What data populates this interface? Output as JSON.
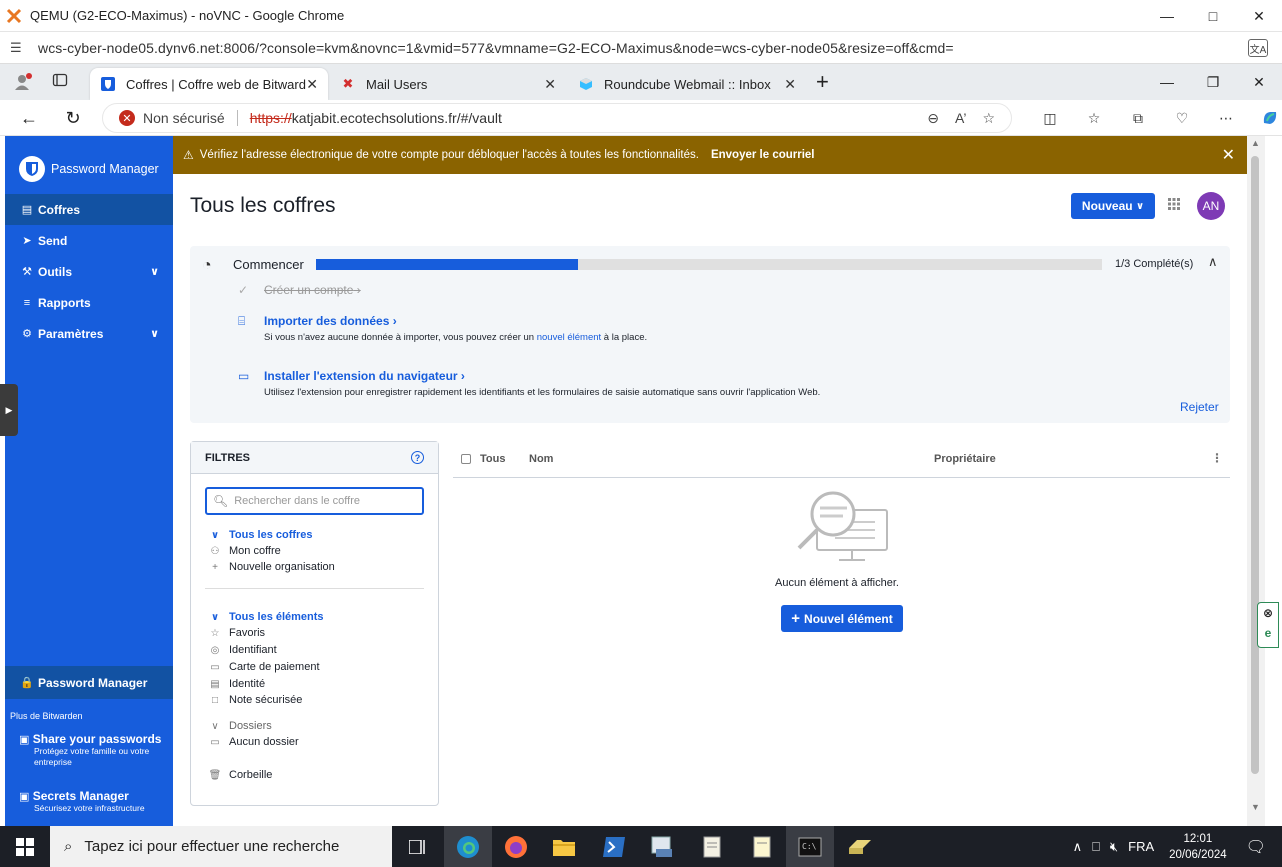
{
  "outer_window": {
    "title": "QEMU (G2-ECO-Maximus) - noVNC - Google Chrome",
    "url": "wcs-cyber-node05.dynv6.net:8006/?console=kvm&novnc=1&vmid=577&vmname=G2-ECO-Maximus&node=wcs-cyber-node05&resize=off&cmd="
  },
  "tabs": [
    {
      "label": "Coffres | Coffre web de Bitwarden",
      "icon": "bitwarden-icon",
      "active": true
    },
    {
      "label": "Mail Users",
      "icon": "mail-icon",
      "active": false
    },
    {
      "label": "Roundcube Webmail :: Inbox",
      "icon": "roundcube-icon",
      "active": false
    }
  ],
  "address": {
    "security_label": "Non sécurisé",
    "scheme": "https://",
    "rest": "katjabit.ecotechsolutions.fr/#/vault"
  },
  "sidebar": {
    "brand": "Password Manager",
    "items": [
      {
        "label": "Coffres",
        "icon": "vault-icon",
        "active": true
      },
      {
        "label": "Send",
        "icon": "send-icon"
      },
      {
        "label": "Outils",
        "icon": "tools-icon",
        "expandable": true
      },
      {
        "label": "Rapports",
        "icon": "reports-icon"
      },
      {
        "label": "Paramètres",
        "icon": "settings-icon",
        "expandable": true
      }
    ],
    "product_switch": "Password Manager",
    "more_label": "Plus de Bitwarden",
    "promos": [
      {
        "title": "Share your passwords",
        "desc": "Protégez votre famille ou votre entreprise"
      },
      {
        "title": "Secrets Manager",
        "desc": "Sécurisez votre infrastructure"
      }
    ]
  },
  "banner": {
    "text": "Vérifiez l'adresse électronique de votre compte pour débloquer l'accès à toutes les fonctionnalités.",
    "link": "Envoyer le courriel"
  },
  "header": {
    "title": "Tous les coffres",
    "new_button": "Nouveau",
    "avatar": "AN"
  },
  "onboarding": {
    "title": "Commencer",
    "progress": 0.333,
    "count": "1/3 Complété(s)",
    "steps": [
      {
        "label": "Créer un compte",
        "done": true
      },
      {
        "label": "Importer des données",
        "desc_before": "Si vous n'avez aucune donnée à importer, vous pouvez créer un ",
        "desc_link": "nouvel élément",
        "desc_after": " à la place."
      },
      {
        "label": "Installer l'extension du navigateur",
        "desc": "Utilisez l'extension pour enregistrer rapidement les identifiants et les formulaires de saisie automatique sans ouvrir l'application Web."
      }
    ],
    "dismiss": "Rejeter"
  },
  "filters": {
    "title": "FILTRES",
    "search_placeholder": "Rechercher dans le coffre",
    "vaults_head": "Tous les coffres",
    "vaults": [
      "Mon coffre",
      "Nouvelle organisation"
    ],
    "items_head": "Tous les éléments",
    "items": [
      "Favoris",
      "Identifiant",
      "Carte de paiement",
      "Identité",
      "Note sécurisée"
    ],
    "folders_head": "Dossiers",
    "folders": [
      "Aucun dossier"
    ],
    "trash": "Corbeille"
  },
  "table": {
    "col_all": "Tous",
    "col_name": "Nom",
    "col_owner": "Propriétaire",
    "empty_text": "Aucun élément à afficher.",
    "new_item_button": "Nouvel élément"
  },
  "taskbar": {
    "search_placeholder": "Tapez ici pour effectuer une recherche",
    "lang": "FRA",
    "time": "12:01",
    "date": "20/06/2024"
  },
  "colors": {
    "brand": "#175ddc",
    "banner": "#8a6300",
    "avatar": "#7e3ab5"
  }
}
